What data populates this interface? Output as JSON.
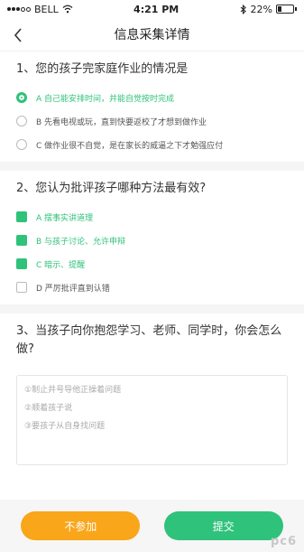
{
  "status_bar": {
    "carrier": "BELL",
    "time": "4:21 PM",
    "battery": "22%",
    "battery_level": 0.22,
    "icons": [
      "signal-dots-icon",
      "wifi-icon",
      "bluetooth-icon",
      "battery-icon"
    ]
  },
  "nav": {
    "title": "信息采集详情",
    "back_icon": "chevron-left-icon"
  },
  "questions": [
    {
      "title": "1、您的孩子完家庭作业的情况是",
      "type": "single",
      "options": [
        {
          "label": "A 自己能安排时间，并能自觉按时完成",
          "selected": true
        },
        {
          "label": "B 先看电视或玩，直到快要返校了才想到做作业",
          "selected": false
        },
        {
          "label": "C 做作业很不自觉，是在家长的威逼之下才勉强应付",
          "selected": false
        }
      ]
    },
    {
      "title": "2、您认为批评孩子哪种方法最有效?",
      "type": "multiple",
      "options": [
        {
          "label": "A 摆事实讲道理",
          "selected": true
        },
        {
          "label": "B 与孩子讨论、允许申辩",
          "selected": true
        },
        {
          "label": "C 暗示、提醒",
          "selected": true
        },
        {
          "label": "D 严厉批评直到认错",
          "selected": false
        }
      ]
    },
    {
      "title": "3、当孩子向你抱怨学习、老师、同学时，你会怎么做?",
      "type": "text",
      "placeholder_lines": [
        "①制止并号导他正操着问题",
        "②顺着孩子说",
        "③要孩子从自身找问题"
      ]
    }
  ],
  "buttons": {
    "decline": "不参加",
    "submit": "提交"
  },
  "watermark": "pc6",
  "colors": {
    "accent_green": "#2fc27b",
    "accent_orange": "#f9a61a"
  }
}
